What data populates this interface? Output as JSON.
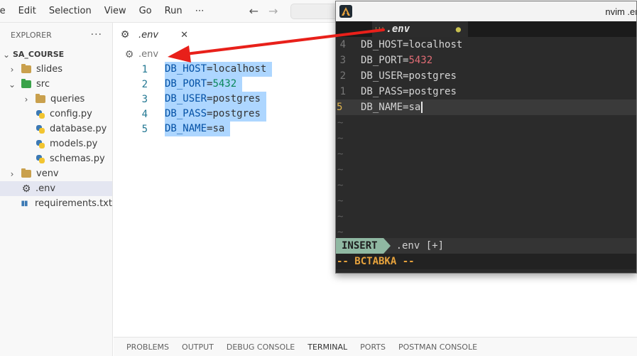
{
  "menubar": {
    "items": [
      "le",
      "Edit",
      "Selection",
      "View",
      "Go",
      "Run",
      "⋯"
    ],
    "back_icon": "arrow-left-icon",
    "forward_icon": "arrow-right-icon"
  },
  "sidebar": {
    "title": "EXPLORER",
    "more": "···",
    "project": "SA_COURSE",
    "tree": [
      {
        "label": "slides",
        "kind": "folder",
        "depth": 1,
        "twisty": "›"
      },
      {
        "label": "src",
        "kind": "folder-green",
        "depth": 1,
        "twisty": "⌄"
      },
      {
        "label": "queries",
        "kind": "folder",
        "depth": 2,
        "twisty": "›"
      },
      {
        "label": "config.py",
        "kind": "python",
        "depth": 2
      },
      {
        "label": "database.py",
        "kind": "python",
        "depth": 2
      },
      {
        "label": "models.py",
        "kind": "python",
        "depth": 2
      },
      {
        "label": "schemas.py",
        "kind": "python",
        "depth": 2
      },
      {
        "label": "venv",
        "kind": "folder",
        "depth": 1,
        "twisty": "›"
      },
      {
        "label": ".env",
        "kind": "gear",
        "depth": 1,
        "selected": true
      },
      {
        "label": "requirements.txt",
        "kind": "req",
        "depth": 1
      }
    ]
  },
  "editor": {
    "tab_label": ".env",
    "tab_close": "✕",
    "breadcrumb": ".env",
    "lines": [
      {
        "num": "1",
        "key": "DB_HOST",
        "eq": "=",
        "value": "localhost"
      },
      {
        "num": "2",
        "key": "DB_PORT",
        "eq": "=",
        "value": "5432"
      },
      {
        "num": "3",
        "key": "DB_USER",
        "eq": "=",
        "value": "postgres"
      },
      {
        "num": "4",
        "key": "DB_PASS",
        "eq": "=",
        "value": "postgres"
      },
      {
        "num": "5",
        "key": "DB_NAME",
        "eq": "=",
        "value": "sa"
      }
    ]
  },
  "panel": {
    "tabs": [
      "PROBLEMS",
      "OUTPUT",
      "DEBUG CONSOLE",
      "TERMINAL",
      "PORTS",
      "POSTMAN CONSOLE"
    ],
    "active": "TERMINAL"
  },
  "nvim": {
    "window_title": "nvim .env",
    "tab_icon_text": "!!!",
    "tab_name": ".env",
    "modified_dot": "●",
    "lines": [
      {
        "num": "4",
        "key": "DB_HOST",
        "eq": "=",
        "value": "localhost"
      },
      {
        "num": "3",
        "key": "DB_PORT",
        "eq": "=",
        "value": "5432"
      },
      {
        "num": "2",
        "key": "DB_USER",
        "eq": "=",
        "value": "postgres"
      },
      {
        "num": "1",
        "key": "DB_PASS",
        "eq": "=",
        "value": "postgres"
      },
      {
        "num": "5",
        "key": "DB_NAME",
        "eq": "=",
        "value": "sa"
      }
    ],
    "tilde": "~",
    "mode": "INSERT",
    "status_file": ".env [+]",
    "cmdline": "-- ВСТАВКА --",
    "colors": {
      "mode_badge": "#8fb8a2",
      "cmdline": "#e6a23c",
      "number": "#e06c75",
      "cursor_line_num": "#e0b44f"
    }
  },
  "annotation": {
    "arrow_color": "#e8201a"
  }
}
